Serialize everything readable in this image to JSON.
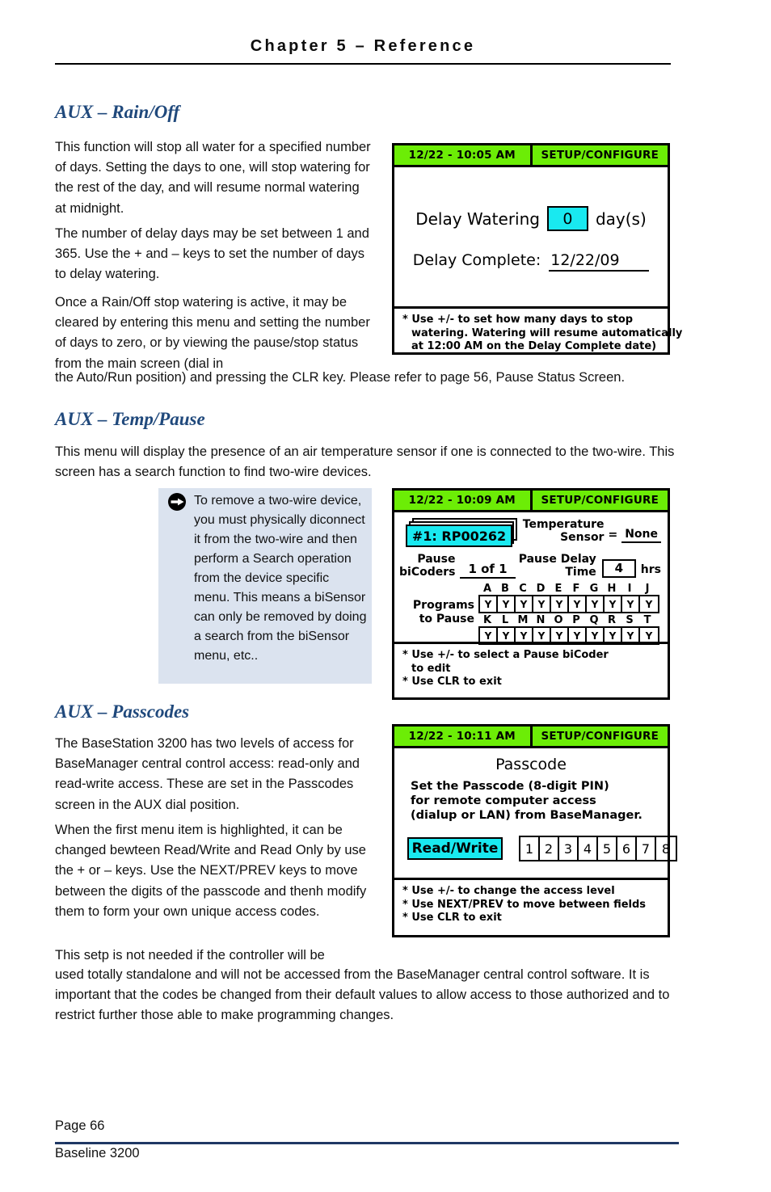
{
  "header": {
    "chapter_title": "Chapter 5 – Reference"
  },
  "sections": {
    "rain_off": {
      "heading": "AUX – Rain/Off",
      "p1": "This function will stop all water for a specified number of days.  Setting the days to one, will stop watering for the rest of the day, and will resume normal watering at midnight.",
      "p2": "The number of delay days may be set between 1 and 365.  Use the + and – keys to set the number of days to delay watering.",
      "p3": "Once a Rain/Off stop watering is active, it may be cleared by entering this menu and setting the number of days to zero, or by viewing the pause/stop status from the main screen (dial in",
      "p4": "the Auto/Run position) and pressing the CLR key.  Please refer to page 56, Pause Status Screen."
    },
    "temp_pause": {
      "heading": "AUX – Temp/Pause",
      "p1": "This menu will display the presence of an air temperature sensor if one is connected to the two-wire.  This screen has a search function to find two-wire devices.",
      "note": "To remove a two-wire device, you must physically diconnect it from the two-wire and then perform a Search operation from the device specific menu.  This means a biSensor can only be removed by doing a search from the biSensor menu, etc.."
    },
    "passcodes": {
      "heading": "AUX – Passcodes",
      "p1": "The BaseStation 3200 has two levels of access for BaseManager central control access:  read-only and read-write access.  These are set in the Passcodes screen in the AUX dial position.",
      "p2": "When the first menu item is highlighted, it can be changed bewteen Read/Write and Read Only by use the + or – keys.  Use the NEXT/PREV keys to move between the digits of the passcode and thenh modify them to form your own unique access codes.",
      "p3": "This setp is not needed if the controller will be",
      "p4": "used totally standalone and will not be accessed from the BaseManager central control software. It is important that the codes be changed from their default values to  allow access to those authorized and to restrict further those able to make programming changes."
    }
  },
  "lcd_rain_off": {
    "title_left": "12/22 - 10:05 AM",
    "title_right": "SETUP/CONFIGURE",
    "delay_watering_label": "Delay Watering",
    "delay_watering_value": "0",
    "delay_watering_units": "day(s)",
    "delay_complete_label": "Delay Complete:",
    "delay_complete_value": "12/22/09",
    "footer_line1": "* Use +/- to set how many days to stop",
    "footer_line2": "watering.  Watering will resume automatically",
    "footer_line3": "at 12:00 AM on the Delay Complete date)"
  },
  "lcd_temp_pause": {
    "title_left": "12/22 - 10:09 AM",
    "title_right": "SETUP/CONFIGURE",
    "bicoder_selected": "#1: RP00262",
    "temp_sensor_label_line1": "Temperature",
    "temp_sensor_label_line2": "Sensor",
    "temp_sensor_eq": "=",
    "temp_sensor_value": "None",
    "pause_bicoders_label_line1": "Pause",
    "pause_bicoders_label_line2": "biCoders",
    "pause_bicoders_value": "1 of 1",
    "pause_delay_label_line1": "Pause Delay",
    "pause_delay_label_line2": "Time",
    "pause_delay_value": "4",
    "pause_delay_units": "hrs",
    "programs_label_line1": "Programs",
    "programs_label_line2": "to Pause",
    "programs_row1_letters": [
      "A",
      "B",
      "C",
      "D",
      "E",
      "F",
      "G",
      "H",
      "I",
      "J"
    ],
    "programs_row1_values": [
      "Y",
      "Y",
      "Y",
      "Y",
      "Y",
      "Y",
      "Y",
      "Y",
      "Y",
      "Y"
    ],
    "programs_row2_letters": [
      "K",
      "L",
      "M",
      "N",
      "O",
      "P",
      "Q",
      "R",
      "S",
      "T"
    ],
    "programs_row2_values": [
      "Y",
      "Y",
      "Y",
      "Y",
      "Y",
      "Y",
      "Y",
      "Y",
      "Y",
      "Y"
    ],
    "footer_line1": "* Use +/- to select a Pause biCoder",
    "footer_line2": "to edit",
    "footer_line3": "* Use CLR to exit"
  },
  "lcd_passcodes": {
    "title_left": "12/22 - 10:11 AM",
    "title_right": "SETUP/CONFIGURE",
    "screen_title": "Passcode",
    "desc_line1": "Set the Passcode (8-digit PIN)",
    "desc_line2": "for remote computer access",
    "desc_line3": "(dialup or LAN) from BaseManager.",
    "access_level": "Read/Write",
    "digits": [
      "1",
      "2",
      "3",
      "4",
      "5",
      "6",
      "7",
      "8"
    ],
    "footer_line1": "* Use +/- to change the access level",
    "footer_line2": "* Use NEXT/PREV to move between fields",
    "footer_line3": "* Use CLR to exit"
  },
  "footer": {
    "page_label": "Page 66",
    "product": "Baseline 3200"
  },
  "colors": {
    "heading_blue": "#20497c",
    "lcd_green": "#6ced06",
    "lcd_cyan": "#19e9f0",
    "note_bg": "#dbe3ef",
    "footer_rule": "#1f3864"
  }
}
